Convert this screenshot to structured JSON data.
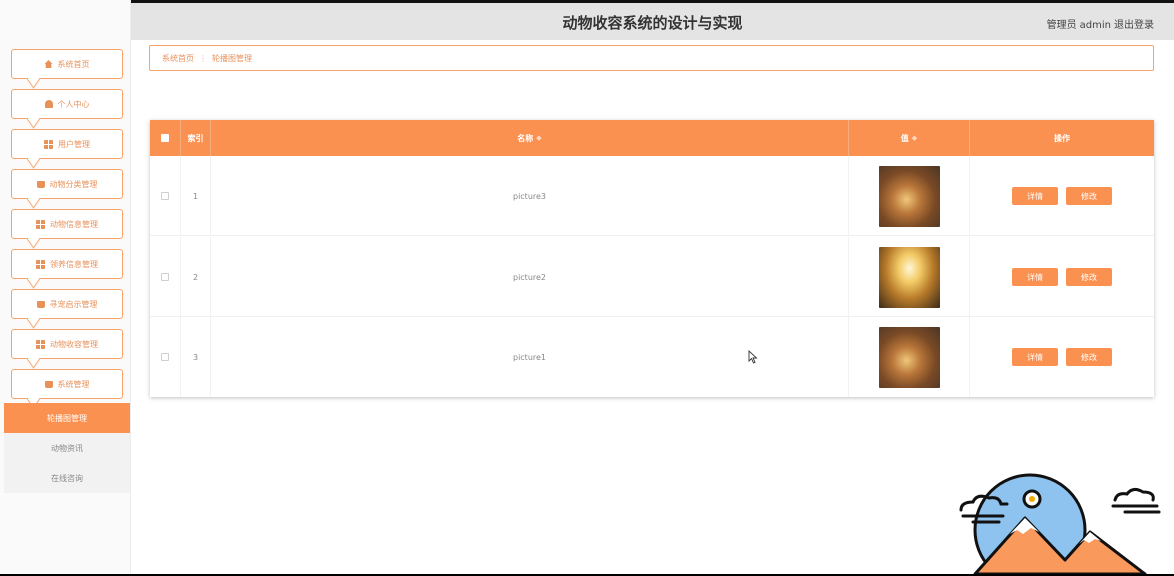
{
  "header": {
    "title": "动物收容系统的设计与实现",
    "role": "管理员",
    "username": "admin",
    "logout": "退出登录"
  },
  "sidebar": {
    "items": [
      {
        "label": "系统首页",
        "icon": "home-icon"
      },
      {
        "label": "个人中心",
        "icon": "person-icon"
      },
      {
        "label": "用户管理",
        "icon": "grid-icon"
      },
      {
        "label": "动物分类管理",
        "icon": "bag-icon"
      },
      {
        "label": "动物信息管理",
        "icon": "grid-icon"
      },
      {
        "label": "领养信息管理",
        "icon": "grid-icon"
      },
      {
        "label": "寻宠启示管理",
        "icon": "bag-icon"
      },
      {
        "label": "动物收容管理",
        "icon": "grid-icon"
      },
      {
        "label": "系统管理",
        "icon": "bag-icon"
      }
    ],
    "subitems": [
      {
        "label": "轮播图管理",
        "active": true
      },
      {
        "label": "动物资讯",
        "active": false
      },
      {
        "label": "在线咨询",
        "active": false
      }
    ]
  },
  "breadcrumb": {
    "home": "系统首页",
    "separator": "⋮",
    "current": "轮播图管理"
  },
  "table": {
    "columns": {
      "index": "索引",
      "name": "名称",
      "value": "值",
      "actions": "操作",
      "sort_icon": "◆"
    },
    "rows": [
      {
        "index": "1",
        "name": "picture3",
        "detail": "详情",
        "edit": "修改"
      },
      {
        "index": "2",
        "name": "picture2",
        "detail": "详情",
        "edit": "修改"
      },
      {
        "index": "3",
        "name": "picture1",
        "detail": "详情",
        "edit": "修改"
      }
    ]
  },
  "colors": {
    "accent": "#fb9150",
    "header_bg": "#e4e4e4",
    "border": "#f5a36a"
  }
}
